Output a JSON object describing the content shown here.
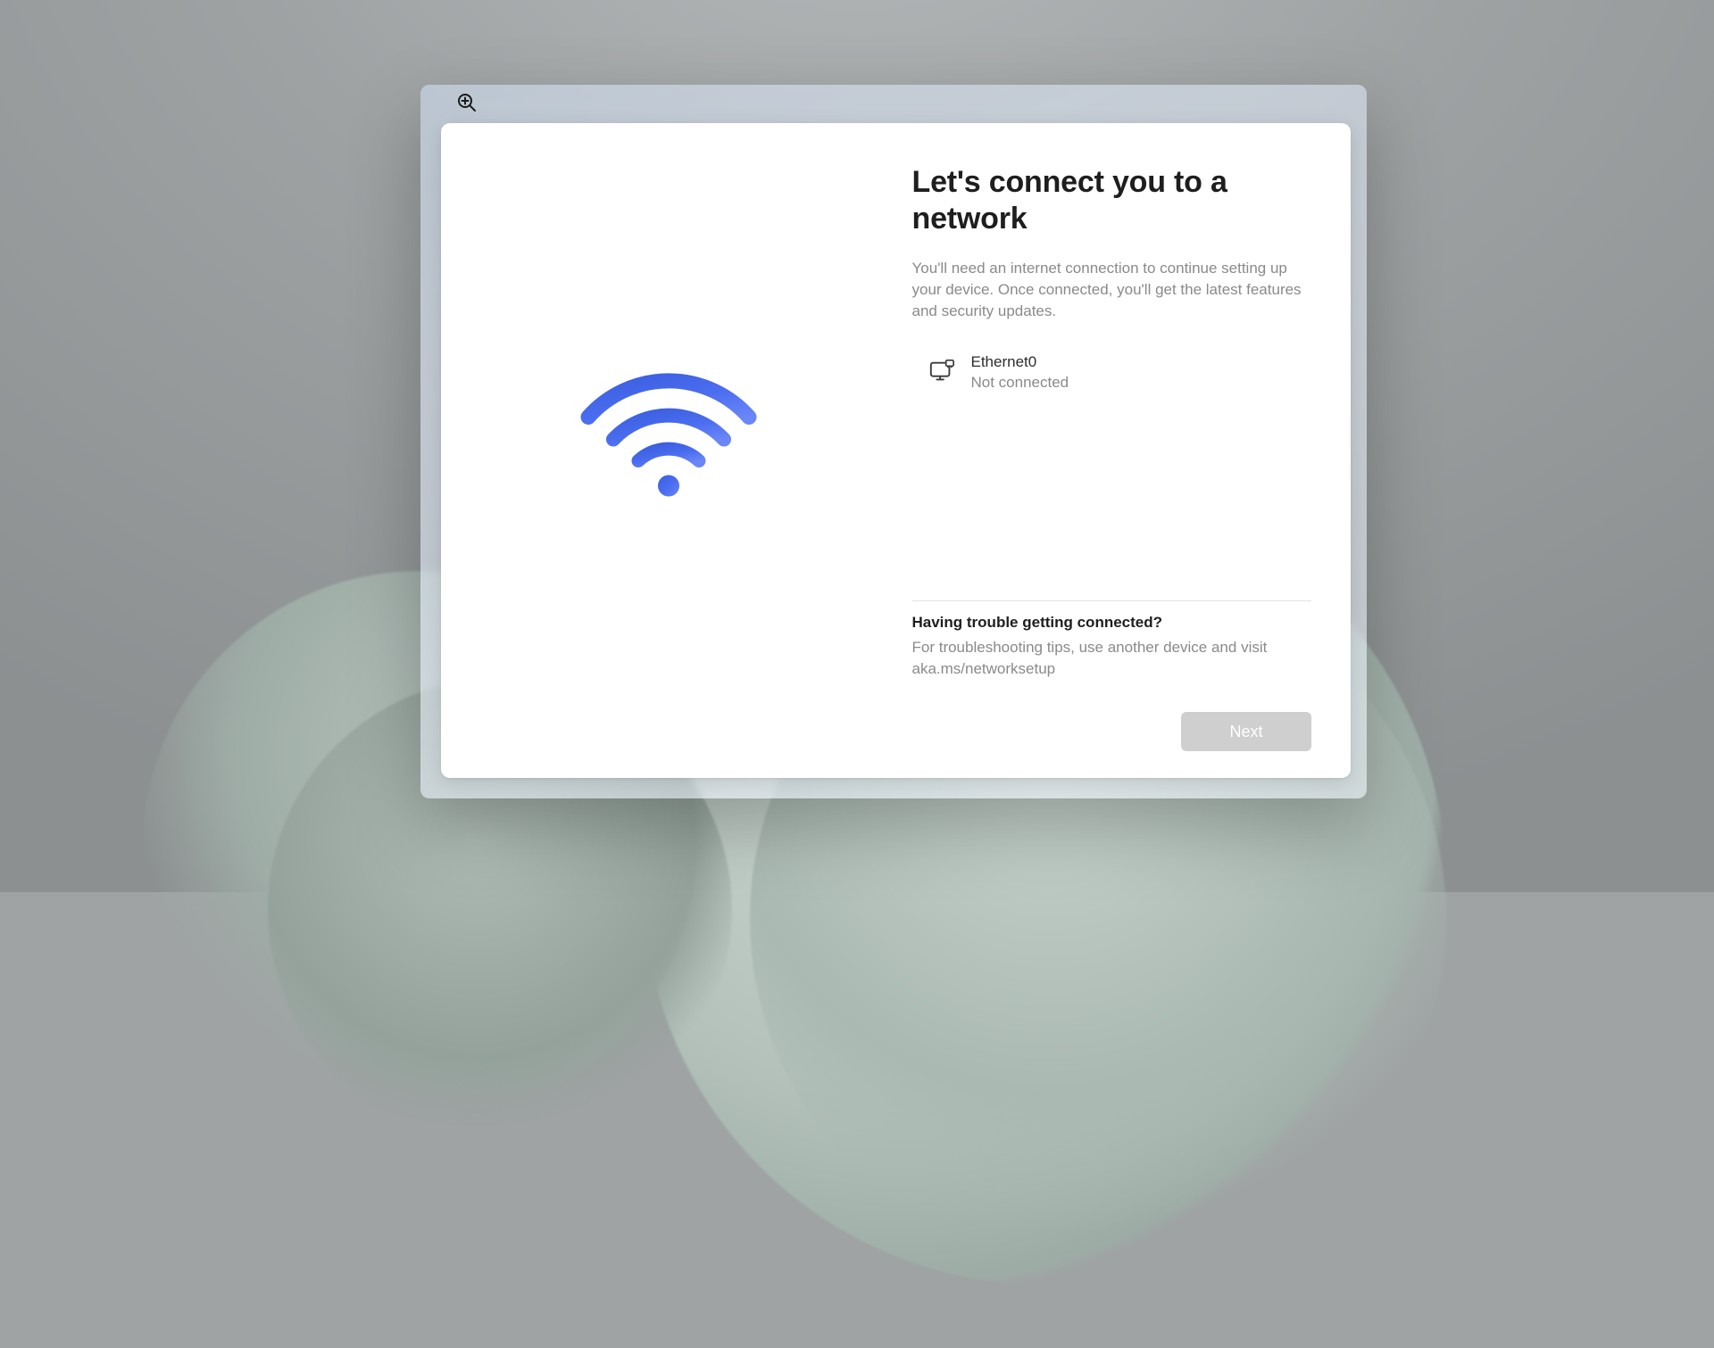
{
  "page": {
    "title": "Let's connect you to a network",
    "subtitle": "You'll need an internet connection to continue setting up your device. Once connected, you'll get the latest features and security updates."
  },
  "networks": [
    {
      "name": "Ethernet0",
      "status": "Not connected"
    }
  ],
  "trouble": {
    "title": "Having trouble getting connected?",
    "text": "For troubleshooting tips, use another device and visit aka.ms/networksetup"
  },
  "buttons": {
    "next": "Next"
  }
}
